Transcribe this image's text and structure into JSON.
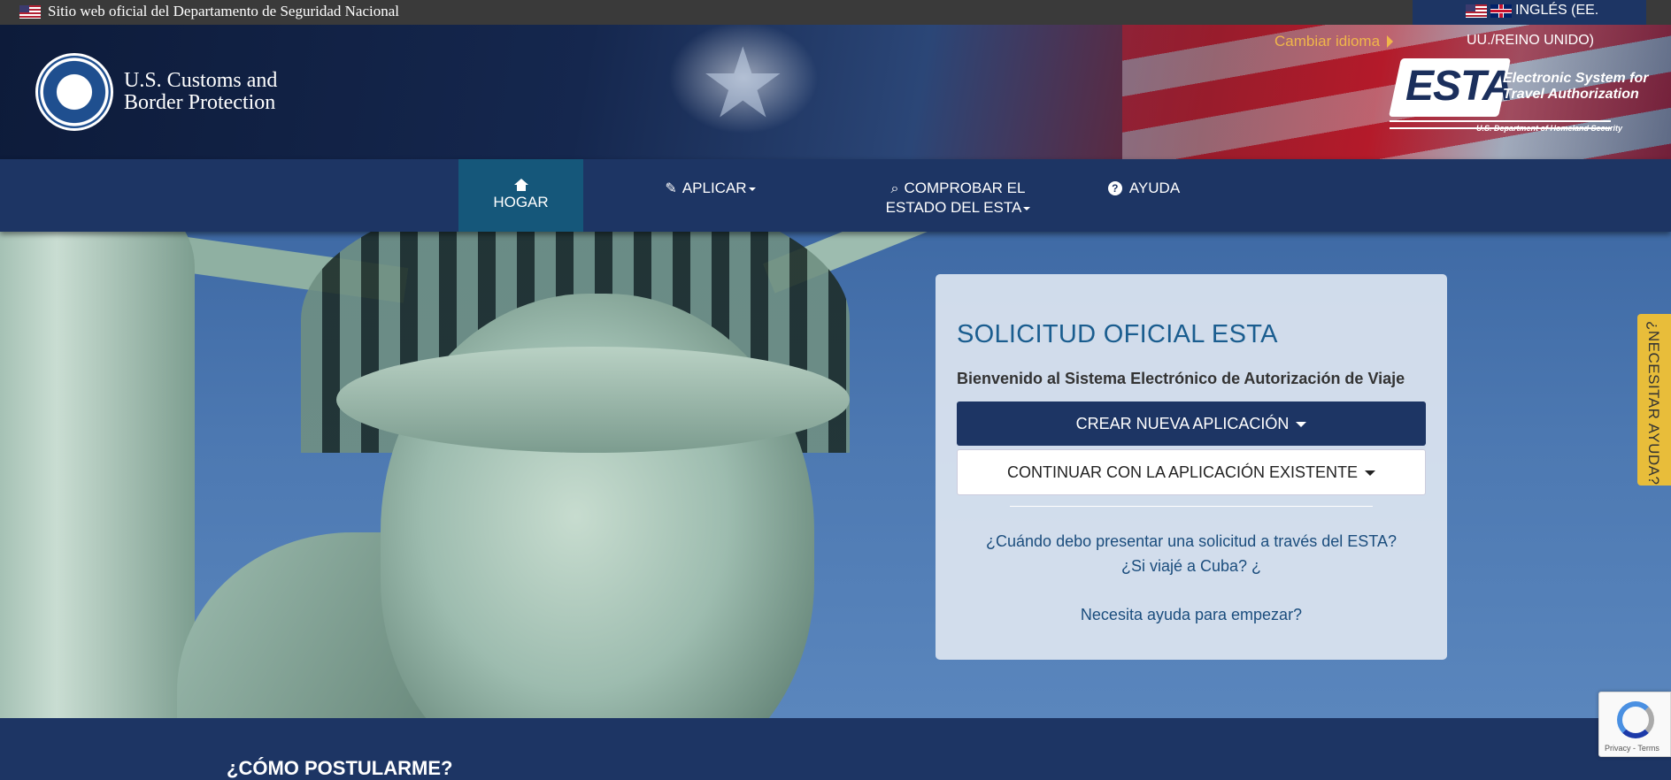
{
  "gov_banner": {
    "text": "Sitio web oficial del Departamento de Seguridad Nacional",
    "language_label": "INGLÉS (EE.",
    "language_label_cont": "UU./REINO UNIDO)",
    "change_language": "Cambiar idioma"
  },
  "header": {
    "agency_line1": "U.S. Customs and",
    "agency_line2": "Border Protection",
    "esta_logo_word": "ESTA",
    "esta_logo_sub_line1": "Electronic System for",
    "esta_logo_sub_line2": "Travel Authorization",
    "esta_logo_dept": "U.S. Department of Homeland Security"
  },
  "nav": {
    "home": "HOGAR",
    "apply": "APLICAR",
    "status_line1": "COMPROBAR EL",
    "status_line2": "ESTADO DEL ESTA",
    "help": "AYUDA"
  },
  "card": {
    "title": "SOLICITUD OFICIAL ESTA",
    "welcome": "Bienvenido al Sistema Electrónico de Autorización de Viaje",
    "create_button": "CREAR NUEVA APLICACIÓN",
    "continue_button": "CONTINUAR CON LA APLICACIÓN EXISTENTE",
    "link_when": "¿Cuándo debo presentar una solicitud a través del ESTA?",
    "link_cuba": "¿Si viajé a Cuba? ¿",
    "link_help": "Necesita ayuda para empezar?"
  },
  "help_tab": "¿NECESITAR AYUDA?",
  "bottom": {
    "title": "¿CÓMO POSTULARME?"
  },
  "recaptcha": {
    "text": "Privacy - Terms"
  },
  "colors": {
    "navy": "#1d3564",
    "active_nav": "#15577a",
    "accent_yellow": "#e8bd3a",
    "title_blue": "#1a5d8f"
  },
  "icons": [
    "us-flag-icon",
    "uk-flag-icon",
    "home-icon",
    "pencil-icon",
    "search-icon",
    "help-circle-icon",
    "caret-down-icon",
    "caret-right-icon",
    "recaptcha-icon"
  ]
}
